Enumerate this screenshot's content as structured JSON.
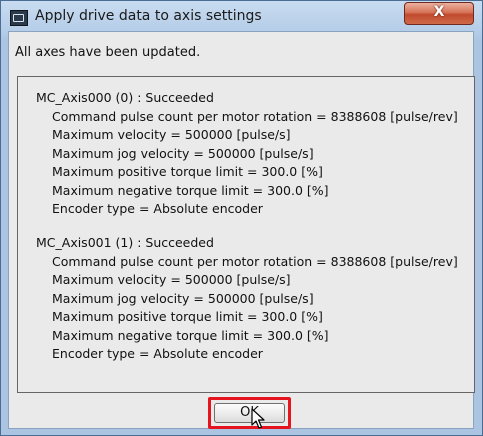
{
  "window": {
    "title": "Apply drive data to axis settings",
    "close_label": "X"
  },
  "summary": "All axes have been updated.",
  "axes": [
    {
      "header": "MC_Axis000 (0) : Succeeded",
      "lines": [
        "Command pulse count per motor rotation = 8388608 [pulse/rev]",
        "Maximum velocity = 500000 [pulse/s]",
        "Maximum jog velocity = 500000 [pulse/s]",
        "Maximum positive torque limit = 300.0 [%]",
        "Maximum negative torque limit = 300.0 [%]",
        "Encoder type = Absolute encoder"
      ]
    },
    {
      "header": "MC_Axis001 (1) : Succeeded",
      "lines": [
        "Command pulse count per motor rotation = 8388608 [pulse/rev]",
        "Maximum velocity = 500000 [pulse/s]",
        "Maximum jog velocity = 500000 [pulse/s]",
        "Maximum positive torque limit = 300.0 [%]",
        "Maximum negative torque limit = 300.0 [%]",
        "Encoder type = Absolute encoder"
      ]
    }
  ],
  "ok_label": "OK"
}
